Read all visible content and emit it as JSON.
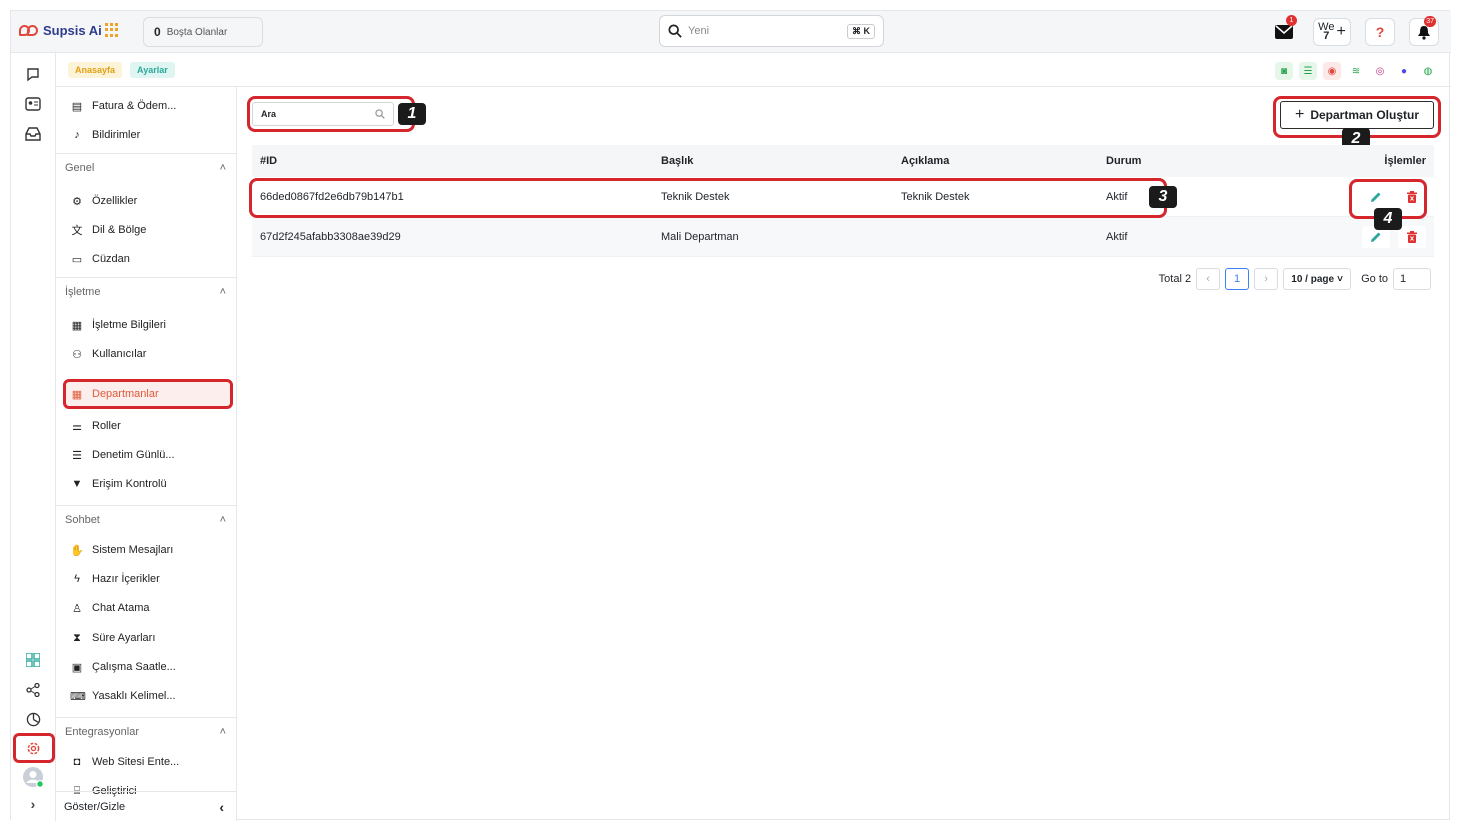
{
  "app": {
    "name": "Supsis Ai"
  },
  "topbar": {
    "idle_count": "0",
    "idle_label": "Boşta Olanlar",
    "search_placeholder": "Yeni",
    "search_shortcut": "⌘ K",
    "mail_badge": "1",
    "we_label": "We",
    "we_sub": "7",
    "notif_badge": "37"
  },
  "breadcrumb": [
    "Anasayfa",
    "Ayarlar"
  ],
  "sidebar": {
    "top_items": [
      {
        "label": "Fatura & Ödem...",
        "icon": "invoice-icon"
      },
      {
        "label": "Bildirimler",
        "icon": "bell-icon"
      }
    ],
    "groups": [
      {
        "title": "Genel",
        "items": [
          {
            "label": "Özellikler",
            "icon": "gear-icon"
          },
          {
            "label": "Dil & Bölge",
            "icon": "translate-icon"
          },
          {
            "label": "Cüzdan",
            "icon": "wallet-icon"
          }
        ]
      },
      {
        "title": "İşletme",
        "items": [
          {
            "label": "İşletme Bilgileri",
            "icon": "building-icon"
          },
          {
            "label": "Kullanıcılar",
            "icon": "users-icon"
          },
          {
            "label": "Departmanlar",
            "icon": "department-icon",
            "active": true
          },
          {
            "label": "Roller",
            "icon": "roles-icon"
          },
          {
            "label": "Denetim Günlü...",
            "icon": "list-icon"
          },
          {
            "label": "Erişim Kontrolü",
            "icon": "access-icon"
          }
        ]
      },
      {
        "title": "Sohbet",
        "items": [
          {
            "label": "Sistem Mesajları",
            "icon": "wave-icon"
          },
          {
            "label": "Hazır İçerikler",
            "icon": "bolt-icon"
          },
          {
            "label": "Chat Atama",
            "icon": "person-icon"
          },
          {
            "label": "Süre Ayarları",
            "icon": "hourglass-icon"
          },
          {
            "label": "Çalışma Saatle...",
            "icon": "calendar-icon"
          },
          {
            "label": "Yasaklı Kelimel...",
            "icon": "keyboard-icon"
          }
        ]
      },
      {
        "title": "Entegrasyonlar",
        "items": [
          {
            "label": "Web Sitesi Ente...",
            "icon": "code-box-icon"
          },
          {
            "label": "Geliştirici",
            "icon": "developer-icon"
          }
        ]
      }
    ],
    "footer_label": "Göster/Gizle"
  },
  "main": {
    "search_placeholder": "Ara",
    "create_button": "Departman Oluştur",
    "annotations": [
      "1",
      "2",
      "3",
      "4"
    ],
    "table": {
      "headers": [
        "#ID",
        "Başlık",
        "Açıklama",
        "Durum",
        "İşlemler"
      ],
      "rows": [
        {
          "id": "66ded0867fd2e6db79b147b1",
          "title": "Teknik Destek",
          "description": "Teknik Destek",
          "status": "Aktif"
        },
        {
          "id": "67d2f245afabb3308ae39d29",
          "title": "Mali Departman",
          "description": "",
          "status": "Aktif"
        }
      ]
    },
    "pagination": {
      "total": "Total 2",
      "current": "1",
      "page_size": "10 / page",
      "goto_label": "Go to",
      "goto_value": "1"
    }
  },
  "colors": {
    "highlight": "#d6262d",
    "edit": "#2ba89b",
    "delete": "#e03131",
    "active": "#e05a3a"
  }
}
